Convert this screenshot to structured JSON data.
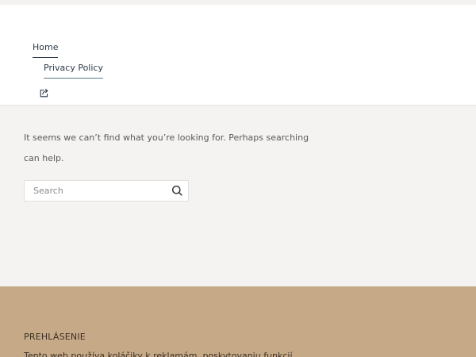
{
  "nav": {
    "items": [
      {
        "label": "Home"
      },
      {
        "label": "Privacy Policy"
      }
    ],
    "share_icon": "share-icon"
  },
  "main": {
    "message": "It seems we can’t find what you’re looking for. Perhaps searching can help.",
    "search": {
      "placeholder": "Search",
      "value": "",
      "button_icon": "search-icon"
    }
  },
  "footer": {
    "heading": "PREHLÁSENIE",
    "text": "Tento web používa koláčiky k reklamám, poskytovaniu funkcií"
  },
  "colors": {
    "page_background": "#f4f3f1",
    "header_background": "#ffffff",
    "footer_background": "#c6aa88",
    "nav_text": "#2b3a4a"
  }
}
